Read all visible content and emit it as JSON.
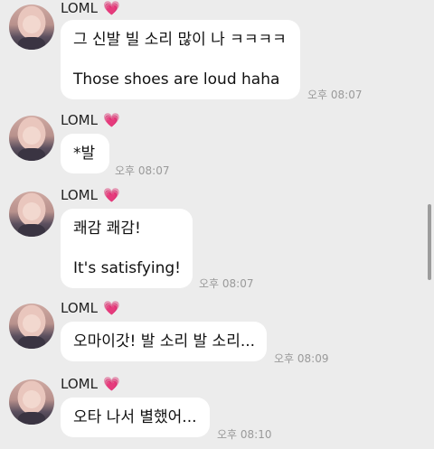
{
  "messages": [
    {
      "sender": "LOML",
      "heart": "💗",
      "lines": [
        "그 신발 빌 소리 많이 나 ㅋㅋㅋㅋ",
        "Those shoes are loud haha"
      ],
      "time": "오후 08:07"
    },
    {
      "sender": "LOML",
      "heart": "💗",
      "lines": [
        "*발"
      ],
      "time": "오후 08:07"
    },
    {
      "sender": "LOML",
      "heart": "💗",
      "lines": [
        "쾌감 쾌감!",
        "It's satisfying!"
      ],
      "time": "오후 08:07"
    },
    {
      "sender": "LOML",
      "heart": "💗",
      "lines": [
        "오마이갓! 발 소리 발 소리..."
      ],
      "time": "오후 08:09"
    },
    {
      "sender": "LOML",
      "heart": "💗",
      "lines": [
        "오타 나서 별했어..."
      ],
      "time": "오후 08:10"
    }
  ],
  "colors": {
    "background": "#ececec",
    "bubble": "#ffffff",
    "heart": "#e05aa0",
    "timestamp": "#9a9a9a"
  }
}
